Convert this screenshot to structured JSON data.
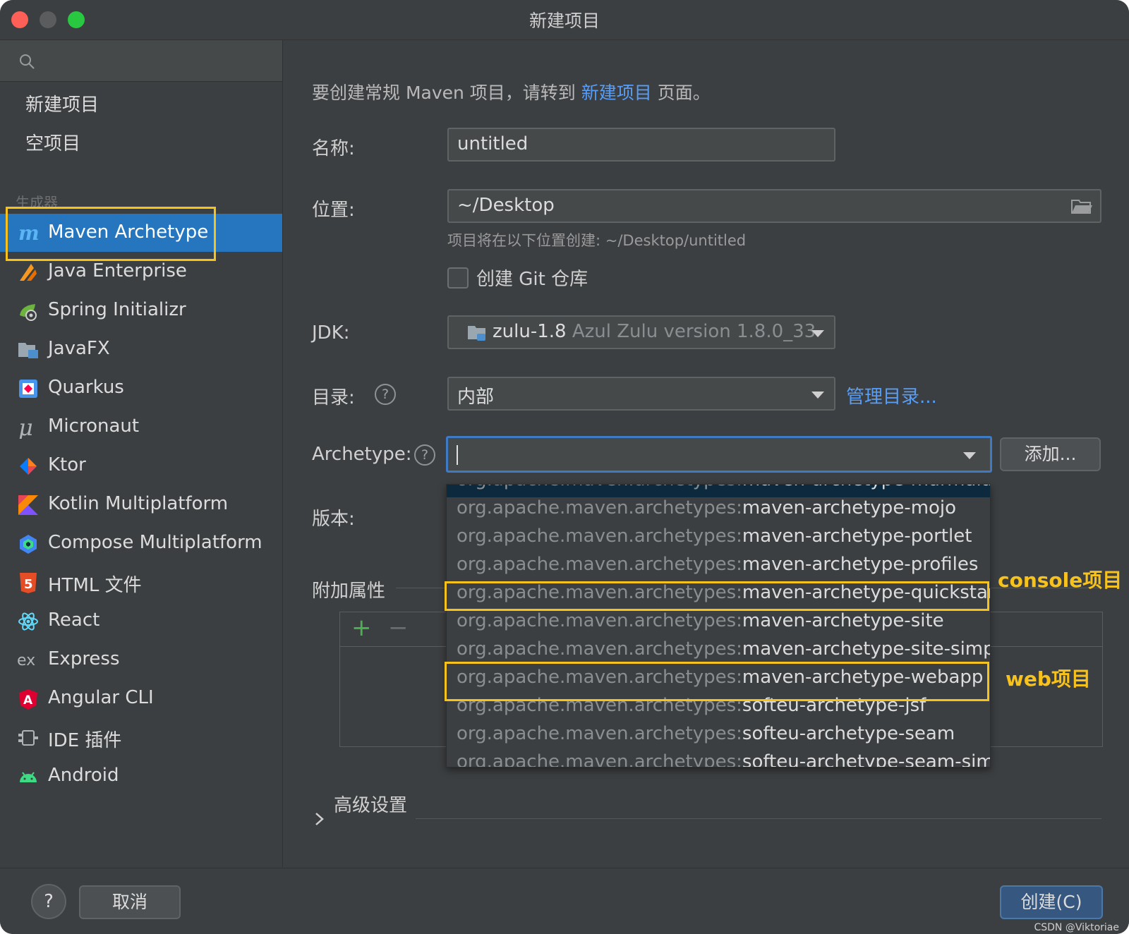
{
  "window": {
    "title": "新建项目"
  },
  "sidebar": {
    "search_placeholder": "",
    "top_items": [
      "新建项目",
      "空项目"
    ],
    "section_label": "生成器",
    "generators": [
      {
        "label": "Maven Archetype",
        "icon": "maven-icon",
        "selected": true
      },
      {
        "label": "Java Enterprise",
        "icon": "java-enterprise-icon"
      },
      {
        "label": "Spring Initializr",
        "icon": "spring-icon"
      },
      {
        "label": "JavaFX",
        "icon": "javafx-icon"
      },
      {
        "label": "Quarkus",
        "icon": "quarkus-icon"
      },
      {
        "label": "Micronaut",
        "icon": "micronaut-icon"
      },
      {
        "label": "Ktor",
        "icon": "ktor-icon"
      },
      {
        "label": "Kotlin Multiplatform",
        "icon": "kotlin-icon"
      },
      {
        "label": "Compose Multiplatform",
        "icon": "compose-icon"
      },
      {
        "label": "HTML 文件",
        "icon": "html5-icon"
      },
      {
        "label": "React",
        "icon": "react-icon"
      },
      {
        "label": "Express",
        "icon": "express-icon"
      },
      {
        "label": "Angular CLI",
        "icon": "angular-icon"
      },
      {
        "label": "IDE 插件",
        "icon": "plugin-icon"
      },
      {
        "label": "Android",
        "icon": "android-icon"
      }
    ]
  },
  "main": {
    "intro_prefix": "要创建常规 Maven 项目，请转到 ",
    "intro_link": "新建项目",
    "intro_suffix": " 页面。",
    "name_label": "名称:",
    "name_value": "untitled",
    "location_label": "位置:",
    "location_value": "~/Desktop",
    "location_hint": "项目将在以下位置创建: ~/Desktop/untitled",
    "git_label": "创建 Git 仓库",
    "git_checked": false,
    "jdk_label": "JDK:",
    "jdk_name": "zulu-1.8",
    "jdk_detail": "Azul Zulu version 1.8.0_33",
    "catalog_label": "目录:",
    "catalog_value": "内部",
    "catalog_manage": "管理目录...",
    "archetype_label": "Archetype:",
    "archetype_value": "",
    "add_button": "添加...",
    "version_label": "版本:",
    "props_label": "附加属性",
    "advanced_label": "高级设置"
  },
  "dropdown": {
    "group_prefix": "org.apache.maven.archetypes:",
    "items": [
      "maven-archetype-marmalade",
      "maven-archetype-mojo",
      "maven-archetype-portlet",
      "maven-archetype-profiles",
      "maven-archetype-quickstart",
      "maven-archetype-site",
      "maven-archetype-site-simple",
      "maven-archetype-webapp",
      "softeu-archetype-jsf",
      "softeu-archetype-seam",
      "softeu-archetype-seam-simp"
    ]
  },
  "annotations": {
    "console": "console项目",
    "web": "web项目",
    "color": "#f7c21b"
  },
  "footer": {
    "help": "?",
    "cancel": "取消",
    "create": "创建(C)",
    "watermark": "CSDN @Viktoriae"
  },
  "colors": {
    "accent": "#2675bf",
    "link": "#589df6",
    "highlight": "#f7c21b"
  }
}
